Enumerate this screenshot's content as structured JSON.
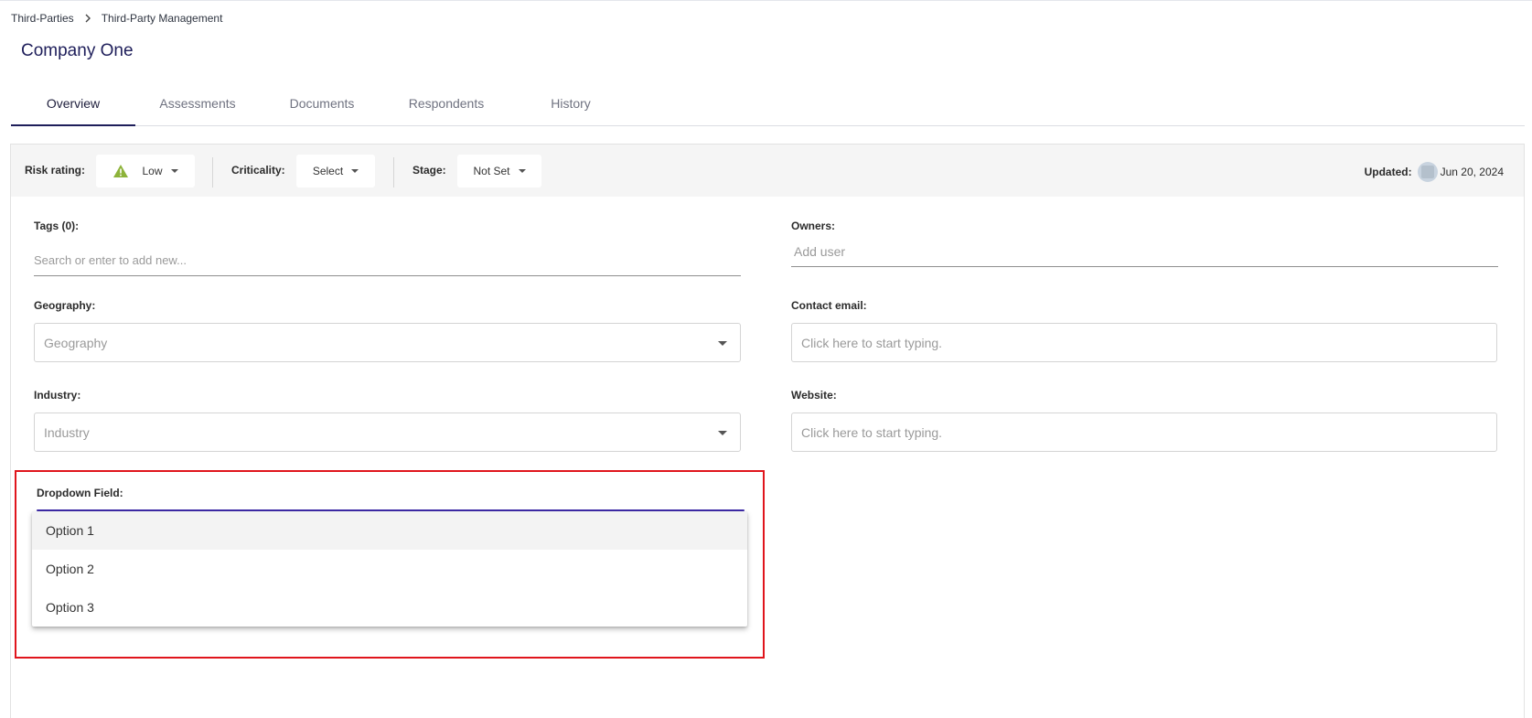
{
  "breadcrumb": {
    "parent": "Third-Parties",
    "current": "Third-Party Management"
  },
  "page_title": "Company One",
  "tabs": [
    {
      "label": "Overview",
      "active": true
    },
    {
      "label": "Assessments"
    },
    {
      "label": "Documents"
    },
    {
      "label": "Respondents"
    },
    {
      "label": "History"
    }
  ],
  "toolbar": {
    "risk_label": "Risk rating:",
    "risk_value": "Low",
    "criticality_label": "Criticality:",
    "criticality_value": "Select",
    "stage_label": "Stage:",
    "stage_value": "Not Set",
    "updated_label": "Updated:",
    "updated_date": "Jun 20, 2024",
    "warn_color": "#8db33a"
  },
  "fields": {
    "tags_label": "Tags (0):",
    "tags_placeholder": "Search or enter to add new...",
    "owners_label": "Owners:",
    "owners_placeholder": "Add user",
    "geography_label": "Geography:",
    "geography_placeholder": "Geography",
    "contact_label": "Contact email:",
    "contact_placeholder": "Click here to start typing.",
    "industry_label": "Industry:",
    "industry_placeholder": "Industry",
    "website_label": "Website:",
    "website_placeholder": "Click here to start typing.",
    "dropdown_label": "Dropdown Field:"
  },
  "dropdown_options": [
    "Option 1",
    "Option 2",
    "Option 3"
  ],
  "colors": {
    "accent": "#3d2ba8",
    "highlight": "#e0151c",
    "title": "#1e1e5a"
  }
}
